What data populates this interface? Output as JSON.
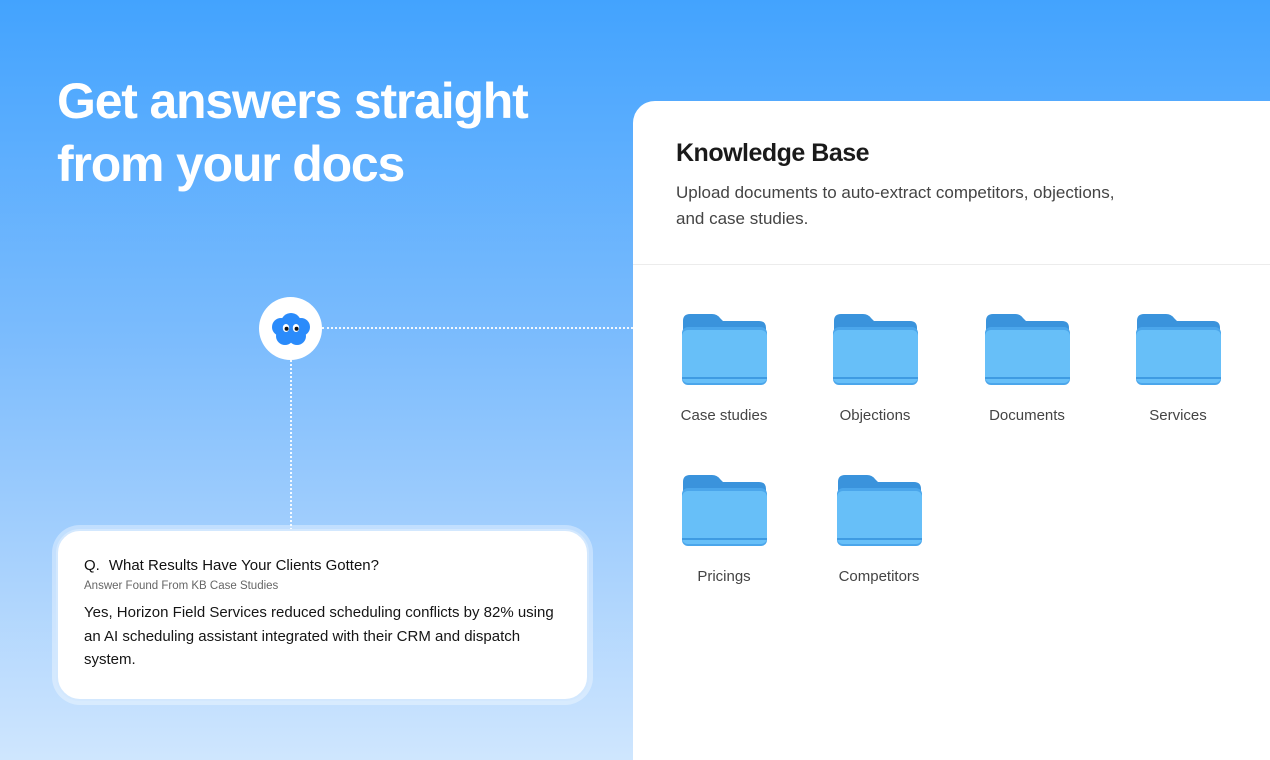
{
  "hero": {
    "title": "Get answers straight from your docs"
  },
  "bot": {
    "icon": "cloud-bot-icon",
    "color": "#2a8bfb"
  },
  "answer_card": {
    "question_prefix": "Q.",
    "question": "What Results Have Your Clients Gotten?",
    "source": "Answer Found From KB Case Studies",
    "answer": "Yes, Horizon Field Services reduced scheduling conflicts by 82% using an AI scheduling assistant integrated with their CRM and dispatch system."
  },
  "knowledge_base": {
    "title": "Knowledge Base",
    "subtitle": "Upload documents to auto-extract competitors, objections, and case studies.",
    "folders": [
      {
        "label": "Case studies",
        "icon": "folder-icon"
      },
      {
        "label": "Objections",
        "icon": "folder-icon"
      },
      {
        "label": "Documents",
        "icon": "folder-icon"
      },
      {
        "label": "Services",
        "icon": "folder-icon"
      },
      {
        "label": "Pricings",
        "icon": "folder-icon"
      },
      {
        "label": "Competitors",
        "icon": "folder-icon"
      }
    ]
  },
  "colors": {
    "background_top": "#43a3fe",
    "background_bottom": "#cfe6fe",
    "folder_blue": "#5cb8f6"
  }
}
